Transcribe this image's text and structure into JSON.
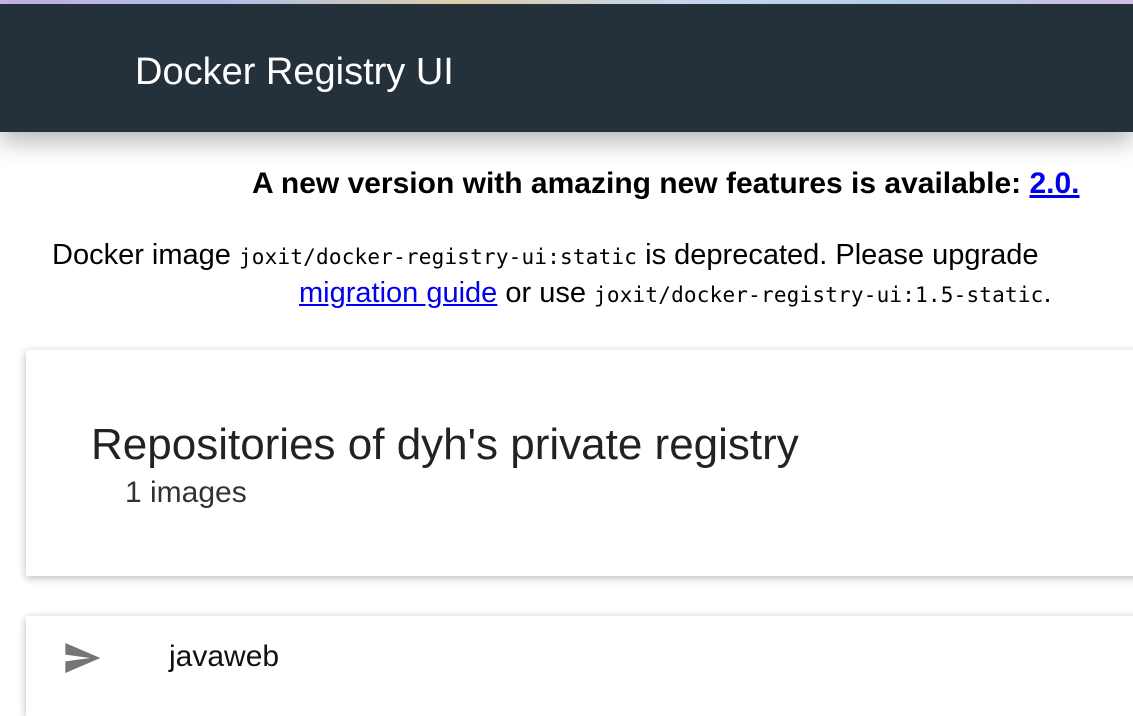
{
  "app": {
    "title": "Docker Registry UI"
  },
  "notice": {
    "text": "A new version with amazing new features is available: ",
    "link_text": "2.0."
  },
  "deprecation": {
    "prefix": "Docker image ",
    "image_old": "joxit/docker-registry-ui:static",
    "middle": " is deprecated. Please upgrade",
    "link_text": "migration guide",
    "or_use": " or use ",
    "image_new": "joxit/docker-registry-ui:1.5-static",
    "suffix": "."
  },
  "registry": {
    "title": "Repositories of dyh's private registry",
    "count_text": "1 images"
  },
  "repositories": [
    {
      "name": "javaweb",
      "icon": "send-icon"
    }
  ],
  "colors": {
    "appbar": "#25313a",
    "link": "#0000ee",
    "icon": "#757575"
  }
}
